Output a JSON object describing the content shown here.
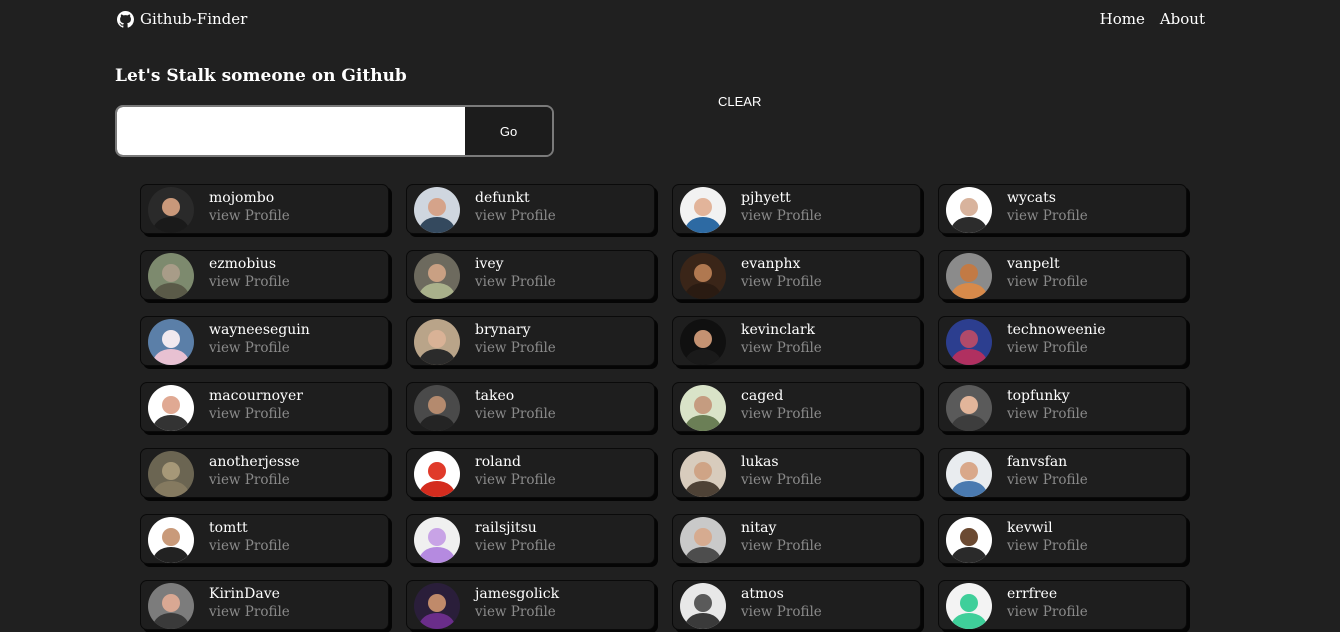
{
  "navbar": {
    "brand": "Github-Finder",
    "links": [
      "Home",
      "About"
    ]
  },
  "search": {
    "heading": "Let's Stalk someone on Github",
    "input_value": "",
    "placeholder": "",
    "go_label": "Go",
    "clear_label": "CLEAR"
  },
  "users": [
    {
      "login": "mojombo",
      "link": "view Profile",
      "bg": "#2a2a2a",
      "skin": "#c9987a",
      "shirt": "#1a1a1a"
    },
    {
      "login": "defunkt",
      "link": "view Profile",
      "bg": "#cfd6df",
      "skin": "#d5a38a",
      "shirt": "#34495e"
    },
    {
      "login": "pjhyett",
      "link": "view Profile",
      "bg": "#f2f2f2",
      "skin": "#e2b49a",
      "shirt": "#2d6aa3"
    },
    {
      "login": "wycats",
      "link": "view Profile",
      "bg": "#ffffff",
      "skin": "#d8b39d",
      "shirt": "#2c2c2c"
    },
    {
      "login": "ezmobius",
      "link": "view Profile",
      "bg": "#7d8a6e",
      "skin": "#a89c88",
      "shirt": "#5a5a48"
    },
    {
      "login": "ivey",
      "link": "view Profile",
      "bg": "#6d6a5e",
      "skin": "#c9a083",
      "shirt": "#a9b18b"
    },
    {
      "login": "evanphx",
      "link": "view Profile",
      "bg": "#3a2518",
      "skin": "#b07850",
      "shirt": "#2a1b12"
    },
    {
      "login": "vanpelt",
      "link": "view Profile",
      "bg": "#8b8b8b",
      "skin": "#c27a45",
      "shirt": "#d88a4a"
    },
    {
      "login": "wayneeseguin",
      "link": "view Profile",
      "bg": "#5b7fa8",
      "skin": "#f1e9ef",
      "shirt": "#e8c1d2"
    },
    {
      "login": "brynary",
      "link": "view Profile",
      "bg": "#b9a489",
      "skin": "#d9b296",
      "shirt": "#2b2b2b"
    },
    {
      "login": "kevinclark",
      "link": "view Profile",
      "bg": "#101010",
      "skin": "#c49272",
      "shirt": "#1a1a1a"
    },
    {
      "login": "technoweenie",
      "link": "view Profile",
      "bg": "#2c3e8f",
      "skin": "#b04a6a",
      "shirt": "#b03060"
    },
    {
      "login": "macournoyer",
      "link": "view Profile",
      "bg": "#ffffff",
      "skin": "#e0a993",
      "shirt": "#333333"
    },
    {
      "login": "takeo",
      "link": "view Profile",
      "bg": "#4a4a4a",
      "skin": "#b48a6e",
      "shirt": "#242424"
    },
    {
      "login": "caged",
      "link": "view Profile",
      "bg": "#d9e3c8",
      "skin": "#c59c80",
      "shirt": "#6b7f56"
    },
    {
      "login": "topfunky",
      "link": "view Profile",
      "bg": "#5a5a5a",
      "skin": "#e2b59a",
      "shirt": "#3d3d3d"
    },
    {
      "login": "anotherjesse",
      "link": "view Profile",
      "bg": "#6b6552",
      "skin": "#a69878",
      "shirt": "#857a60"
    },
    {
      "login": "roland",
      "link": "view Profile",
      "bg": "#ffffff",
      "skin": "#e03a2a",
      "shirt": "#d42c1e"
    },
    {
      "login": "lukas",
      "link": "view Profile",
      "bg": "#d8ccbd",
      "skin": "#cfa486",
      "shirt": "#4e4236"
    },
    {
      "login": "fanvsfan",
      "link": "view Profile",
      "bg": "#e9ecef",
      "skin": "#d9a88a",
      "shirt": "#4a7ab0"
    },
    {
      "login": "tomtt",
      "link": "view Profile",
      "bg": "#ffffff",
      "skin": "#c99a7a",
      "shirt": "#222222"
    },
    {
      "login": "railsjitsu",
      "link": "view Profile",
      "bg": "#f0f0f0",
      "skin": "#c8a3e6",
      "shirt": "#b58ae0"
    },
    {
      "login": "nitay",
      "link": "view Profile",
      "bg": "#c9c9c9",
      "skin": "#d6ab90",
      "shirt": "#4d4d4d"
    },
    {
      "login": "kevwil",
      "link": "view Profile",
      "bg": "#ffffff",
      "skin": "#6b4a32",
      "shirt": "#2a2a2a"
    },
    {
      "login": "KirinDave",
      "link": "view Profile",
      "bg": "#7c7c7c",
      "skin": "#d9a893",
      "shirt": "#3a3a3a"
    },
    {
      "login": "jamesgolick",
      "link": "view Profile",
      "bg": "#2a1e3a",
      "skin": "#c08a6a",
      "shirt": "#6a2d8a"
    },
    {
      "login": "atmos",
      "link": "view Profile",
      "bg": "#e8e8e8",
      "skin": "#5a5a5a",
      "shirt": "#3a3a3a"
    },
    {
      "login": "errfree",
      "link": "view Profile",
      "bg": "#f3f3f3",
      "skin": "#3fcf9a",
      "shirt": "#3fcf9a"
    }
  ]
}
